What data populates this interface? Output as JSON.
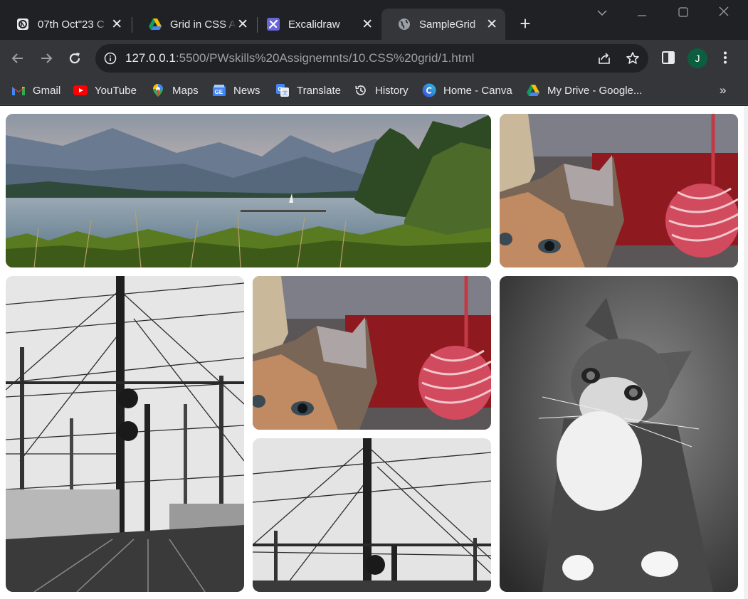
{
  "window": {
    "page_title": "SampleGrid"
  },
  "tabs": [
    {
      "title": "07th Oct\"23 C",
      "favicon": "notion-like-icon"
    },
    {
      "title": "Grid in CSS A",
      "favicon": "google-drive-icon"
    },
    {
      "title": "Excalidraw",
      "favicon": "excalidraw-icon"
    },
    {
      "title": "SampleGrid",
      "favicon": "globe-icon",
      "active": true
    }
  ],
  "address_bar": {
    "host": "127.0.0.1",
    "path": ":5500/PWskills%20Assignemnts/10.CSS%20grid/1.html"
  },
  "profile": {
    "initial": "J",
    "color": "#0b5e3f"
  },
  "bookmarks": [
    {
      "label": "Gmail",
      "icon": "gmail-icon"
    },
    {
      "label": "YouTube",
      "icon": "youtube-icon"
    },
    {
      "label": "Maps",
      "icon": "maps-icon"
    },
    {
      "label": "News",
      "icon": "news-icon"
    },
    {
      "label": "Translate",
      "icon": "translate-icon"
    },
    {
      "label": "History",
      "icon": "history-icon"
    },
    {
      "label": "Home - Canva",
      "icon": "canva-icon"
    },
    {
      "label": "My Drive - Google...",
      "icon": "google-drive-icon"
    }
  ],
  "bookmarks_overflow": "»",
  "gallery": [
    {
      "subject": "lake-landscape"
    },
    {
      "subject": "kitten-with-yarn-ball"
    },
    {
      "subject": "railway-power-lines-bw"
    },
    {
      "subject": "kitten-with-yarn-ball"
    },
    {
      "subject": "kitten-bw"
    },
    {
      "subject": "railway-power-lines-bw"
    }
  ],
  "colors": {
    "tabstrip": "#202124",
    "toolbar": "#35363a",
    "page_bg": "#ffffff"
  }
}
